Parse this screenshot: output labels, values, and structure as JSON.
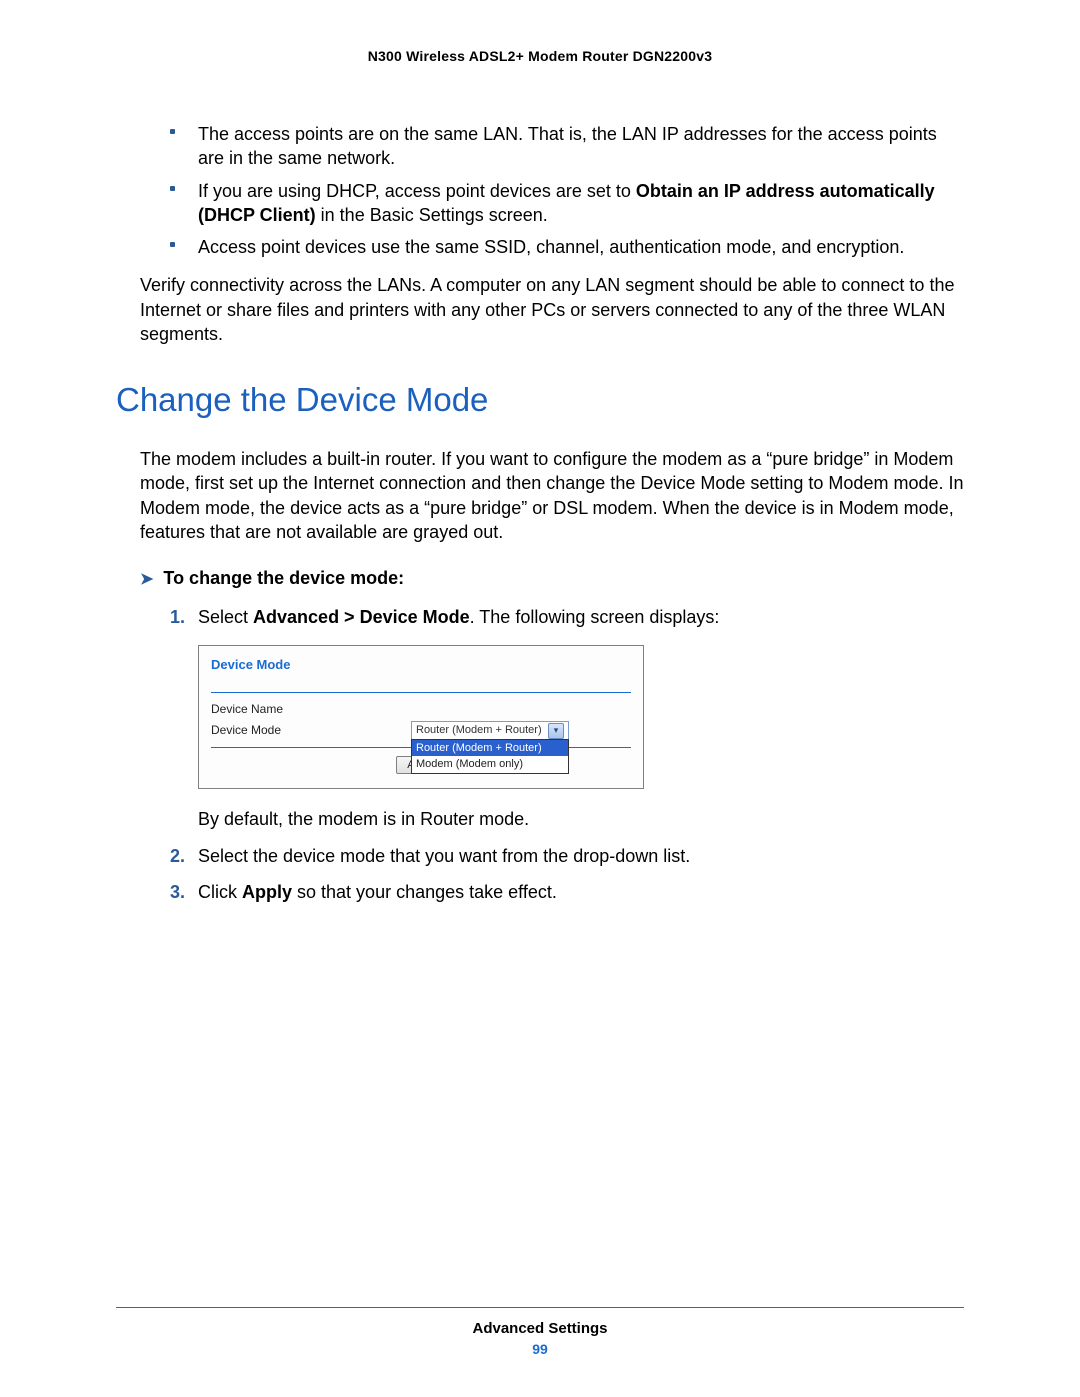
{
  "header": {
    "title": "N300 Wireless ADSL2+ Modem Router DGN2200v3"
  },
  "bullets": [
    {
      "pre": "The access points are on the same LAN. That is, the LAN IP addresses for the access points are in the same network."
    },
    {
      "pre": "If you are using DHCP, access point devices are set to ",
      "bold": "Obtain an IP address automatically (DHCP Client)",
      "post": " in the Basic Settings screen."
    },
    {
      "pre": "Access point devices use the same SSID, channel, authentication mode, and encryption."
    }
  ],
  "verify_text": "Verify connectivity across the LANs. A computer on any LAN segment should be able to connect to the Internet or share files and printers with any other PCs or servers connected to any of the three WLAN segments.",
  "section_heading": "Change the Device Mode",
  "intro_text": "The modem includes a built-in router. If you want to configure the modem as a “pure bridge” in Modem mode, first set up the Internet connection and then change the Device Mode setting to Modem mode. In Modem mode, the device acts as a “pure bridge” or DSL modem. When the device is in Modem mode, features that are not available are grayed out.",
  "task_label": "To change the device mode:",
  "steps": {
    "s1_pre": "Select ",
    "s1_bold": "Advanced > Device Mode",
    "s1_post": ". The following screen displays:",
    "s1_note": "By default, the modem is in Router mode.",
    "s2": "Select the device mode that you want from the drop-down list.",
    "s3_pre": "Click ",
    "s3_bold": "Apply",
    "s3_post": " so that your changes take effect."
  },
  "device_box": {
    "title": "Device Mode",
    "label_name": "Device Name",
    "label_mode": "Device Mode",
    "selected": "Router (Modem + Router)",
    "opt1": "Router (Modem + Router)",
    "opt2": "Modem (Modem only)",
    "apply": "Apply"
  },
  "footer": {
    "section": "Advanced Settings",
    "page": "99"
  }
}
